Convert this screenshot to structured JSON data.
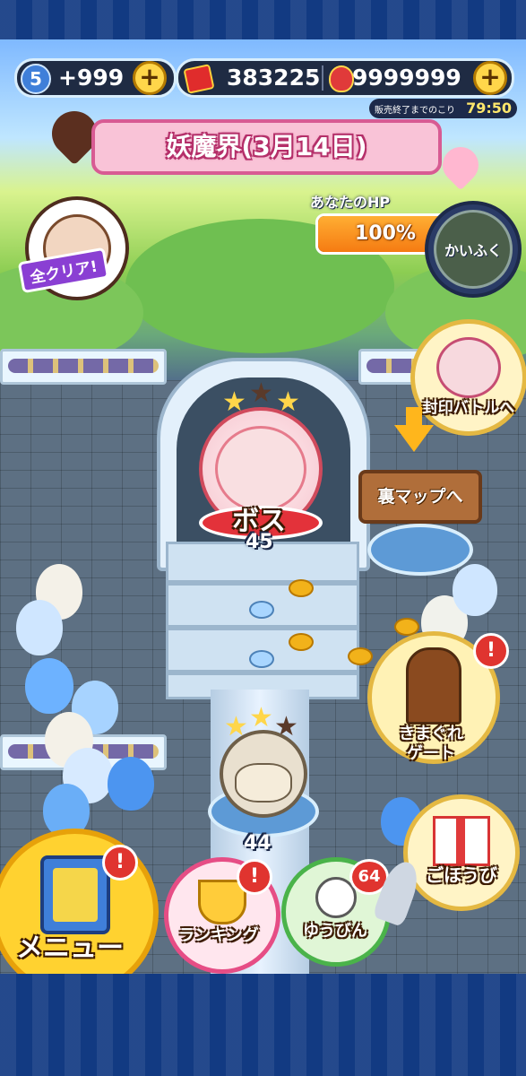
{
  "hud": {
    "stamina_count": "5",
    "stamina_value": "+999",
    "money_value": "383225",
    "gem_value": "9999999",
    "plus_label": "+",
    "timer_label": "販売終了までのこり",
    "timer_value": "79:50"
  },
  "banner": {
    "title": "妖魔界(3月14日)"
  },
  "left_badge": {
    "label": "全クリア!"
  },
  "hp": {
    "label": "あなたのHP",
    "value": "100%",
    "fill_fraction": 1.0,
    "recover_label": "かいふく"
  },
  "seal_battle": {
    "label": "封印バトルへ"
  },
  "boss": {
    "label": "ボス",
    "level": "45",
    "stars": 3
  },
  "back_map": {
    "label": "裏マップへ"
  },
  "gate": {
    "label_line1": "きまぐれ",
    "label_line2": "ゲート",
    "alert": "!"
  },
  "character": {
    "level": "44",
    "stars": 3
  },
  "reward": {
    "label": "ごほうび"
  },
  "bottom_nav": {
    "menu_label": "メニュー",
    "menu_alert": "!",
    "ranking_label": "ランキング",
    "ranking_alert": "!",
    "mail_label": "ゆうびん",
    "mail_count": "64"
  },
  "colors": {
    "accent_gold": "#ffd64a",
    "banner_pink": "#f9c3d7",
    "alert_red": "#e0342f",
    "hp_orange": "#f57b12"
  }
}
